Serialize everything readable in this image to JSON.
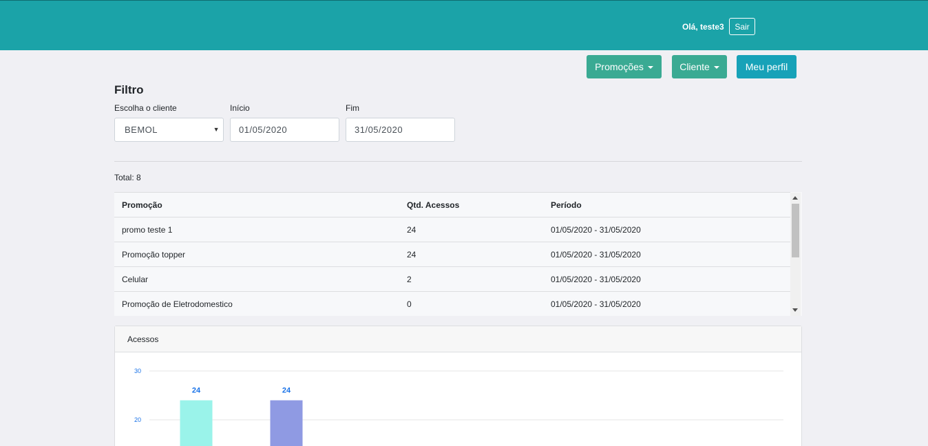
{
  "header": {
    "greeting": "Olá, teste3",
    "logout_label": "Sair"
  },
  "nav": {
    "promotions_label": "Promoções",
    "client_label": "Cliente",
    "profile_label": "Meu perfil"
  },
  "filter": {
    "title": "Filtro",
    "client_label": "Escolha o cliente",
    "client_value": "BEMOL",
    "start_label": "Início",
    "start_value": "01/05/2020",
    "end_label": "Fim",
    "end_value": "31/05/2020"
  },
  "summary": {
    "total": "Total: 8"
  },
  "table": {
    "headers": [
      "Promoção",
      "Qtd. Acessos",
      "Período"
    ],
    "rows": [
      [
        "promo teste 1",
        "24",
        "01/05/2020 - 31/05/2020"
      ],
      [
        "Promoção topper",
        "24",
        "01/05/2020 - 31/05/2020"
      ],
      [
        "Celular",
        "2",
        "01/05/2020 - 31/05/2020"
      ],
      [
        "Promoção de Eletrodomestico",
        "0",
        "01/05/2020 - 31/05/2020"
      ]
    ]
  },
  "chart_card": {
    "title": "Acessos"
  },
  "chart_data": {
    "type": "bar",
    "title": "",
    "xlabel": "",
    "ylabel": "",
    "ylim": [
      0,
      30
    ],
    "yticks_visible": [
      30,
      20
    ],
    "grid": true,
    "values": [
      24,
      24
    ],
    "colors": [
      "#9af3ea",
      "#8f9ae3"
    ],
    "data_label_color": "#1a73e8"
  }
}
